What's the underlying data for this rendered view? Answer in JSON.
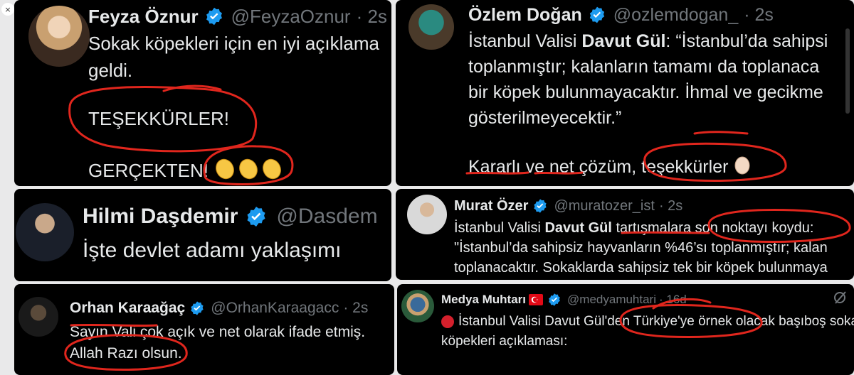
{
  "close": {
    "label": "×"
  },
  "tweets": {
    "feyza": {
      "name": "Feyza Öznur",
      "handle": "@FeyzaOznur",
      "time": "· 2s",
      "line1": "Sokak köpekleri için en iyi açıklama",
      "line2": "geldi.",
      "line3": "TEŞEKKÜRLER!",
      "line4": "GERÇEKTEN!"
    },
    "ozlem": {
      "name": "Özlem Doğan",
      "handle": "@ozlemdogan_",
      "time": "· 2s",
      "l1_a": "İstanbul Valisi ",
      "l1_b": "Davut Gül",
      "l1_c": ": “İstanbul’da sahipsi",
      "line2": "toplanmıştır; kalanların tamamı da toplanaca",
      "line3": "bir köpek bulunmayacaktır. İhmal ve gecikme",
      "line4": "gösterilmeyecektir.”",
      "line5": "Kararlı ve net çözüm, teşekkürler"
    },
    "hilmi": {
      "name": "Hilmi Daşdemir",
      "handle": "@Dasdem",
      "line1": "İşte devlet adamı yaklaşımı"
    },
    "murat": {
      "name": "Murat Özer",
      "handle": "@muratozer_ist",
      "time": "· 2s",
      "l1_a": "İstanbul Valisi ",
      "l1_b": "Davut Gül",
      "l1_c": " tartışmalara son noktayı koydu:",
      "line2": "\"İstanbul’da sahipsiz hayvanların %46’sı toplanmıştır; kalan",
      "line3": "toplanacaktır. Sokaklarda sahipsiz tek bir köpek bulunmaya"
    },
    "orhan": {
      "name": "Orhan Karaağaç",
      "handle": "@OrhanKaraagacc",
      "time": "· 2s",
      "line1": "Sayın Vali çok açık ve net olarak ifade etmiş.",
      "line2": "Allah Razı olsun."
    },
    "medya": {
      "name": "Medya Muhtarı",
      "handle": "@medyamuhtari",
      "time": "· 16d",
      "line1": "İstanbul Valisi Davut Gül'den Türkiye'ye örnek olacak başıboş sokak",
      "line2": "köpekleri açıklaması:"
    }
  },
  "colors": {
    "ink": "#e0261d",
    "verified": "#1d9bf0",
    "handle": "#71767b"
  },
  "icons": [
    "verified-badge-icon",
    "clapping-hands-icon",
    "waving-hand-icon",
    "turkey-flag-icon",
    "red-circle-icon",
    "grok-icon",
    "close-icon"
  ]
}
